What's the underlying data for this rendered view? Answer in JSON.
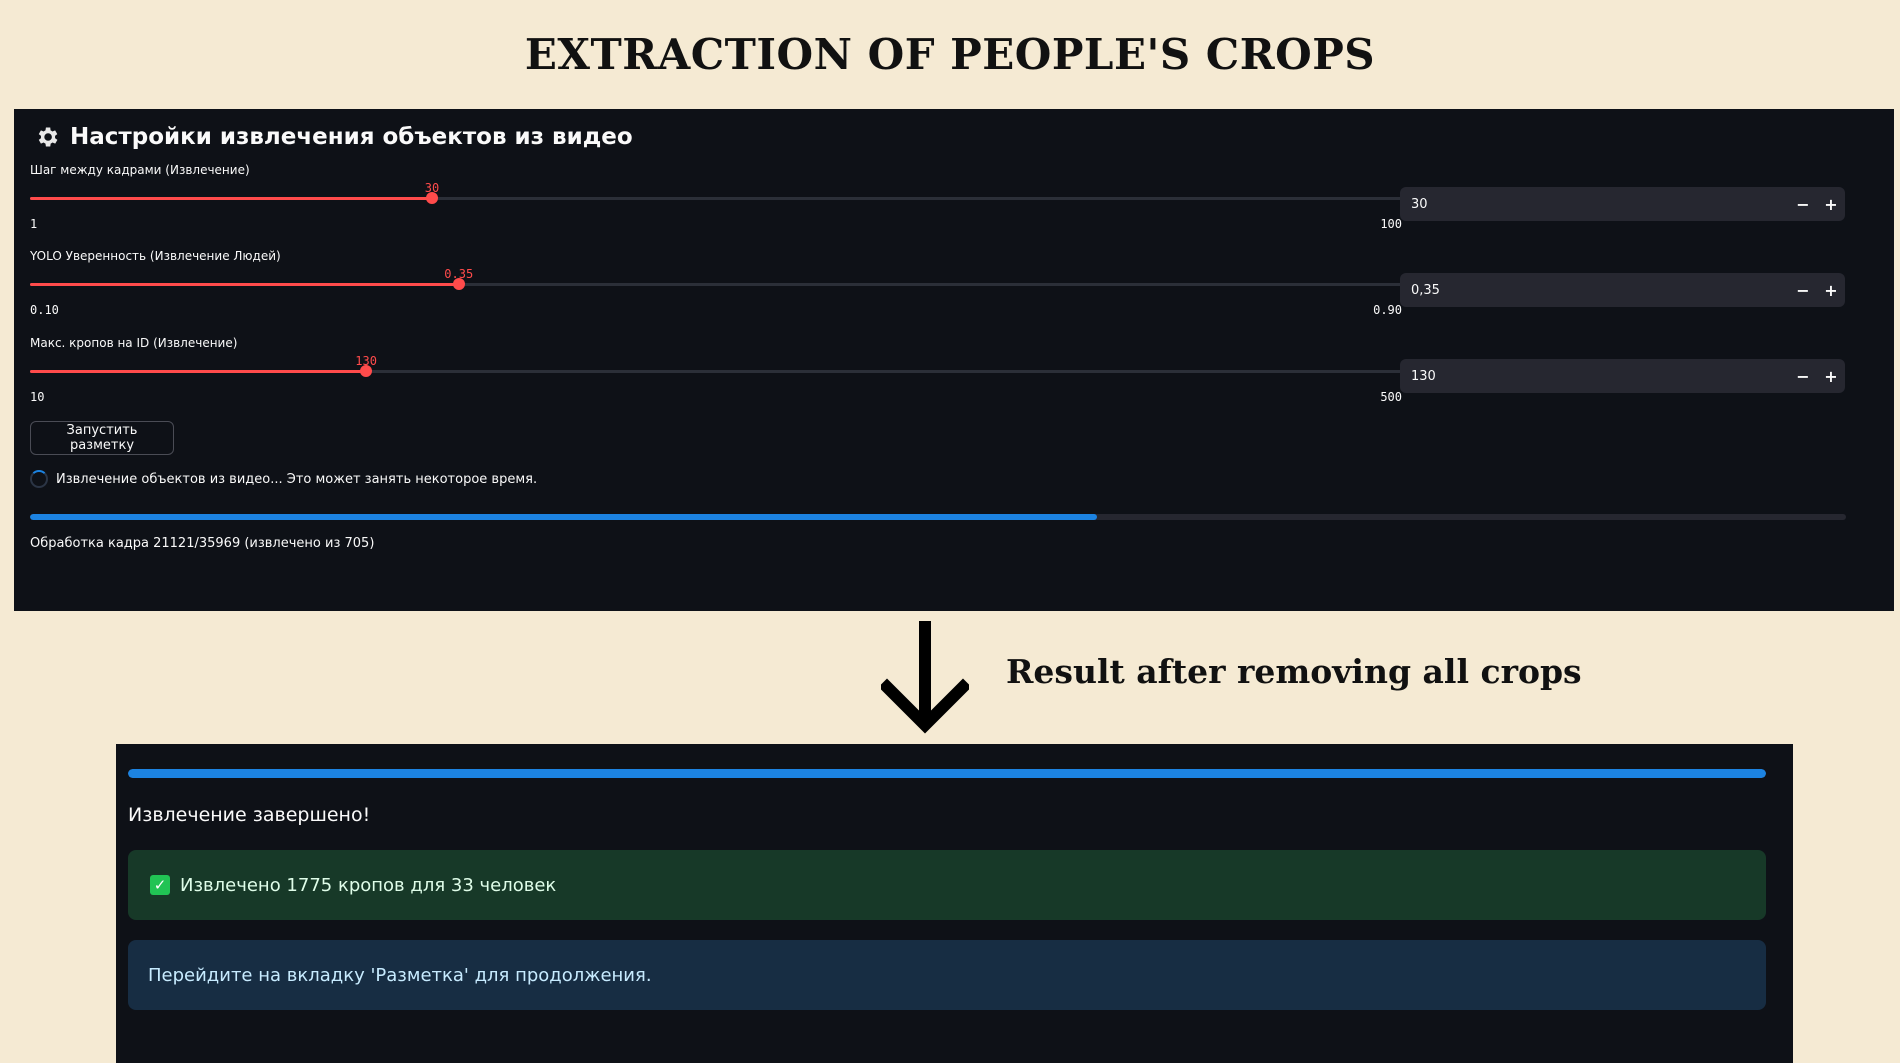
{
  "title": "EXTRACTION OF PEOPLE'S CROPS",
  "settings": {
    "header": "Настройки извлечения объектов из видео",
    "header_icon": "gear-icon",
    "sliders": [
      {
        "label": "Шаг между кадрами (Извлечение)",
        "value": "30",
        "min": "1",
        "max": "100",
        "fraction": 0.293,
        "input_value": "30"
      },
      {
        "label": "YOLO Уверенность (Извлечение Людей)",
        "value": "0.35",
        "min": "0.10",
        "max": "0.90",
        "fraction": 0.3125,
        "input_value": "0,35"
      },
      {
        "label": "Макс. кропов на ID (Извлечение)",
        "value": "130",
        "min": "10",
        "max": "500",
        "fraction": 0.245,
        "input_value": "130"
      }
    ],
    "stepper_minus": "−",
    "stepper_plus": "+",
    "run_button": "Запустить разметку",
    "spinner_text": "Извлечение объектов из видео... Это может занять некоторое время.",
    "progress_fraction": 0.5873,
    "status": "Обработка кадра 21121/35969 (извлечено из 705)"
  },
  "caption": "Result after removing all crops",
  "result": {
    "progress_fraction": 1.0,
    "done": "Извлечение завершено!",
    "success": "Извлечено 1775 кропов для 33 человек",
    "success_icon": "✓",
    "info": "Перейдите на вкладку 'Разметка' для продолжения."
  },
  "colors": {
    "background": "#f5ead3",
    "panel": "#0e1117",
    "accent_red": "#ff4b4b",
    "progress_blue": "#1c83e1",
    "success_bg": "#173928",
    "info_bg": "#172d43"
  }
}
